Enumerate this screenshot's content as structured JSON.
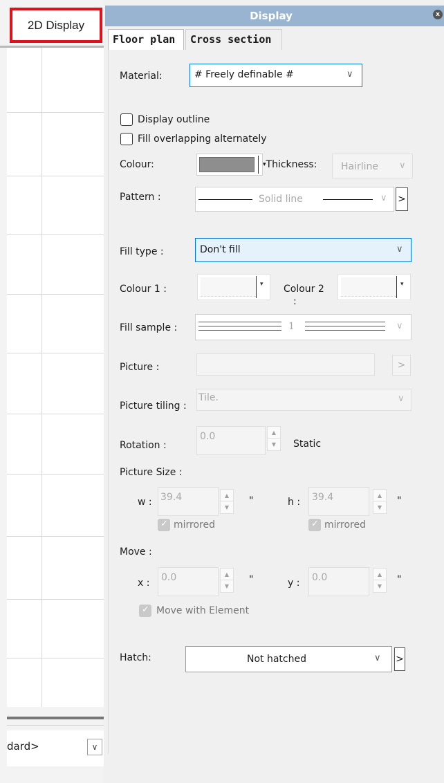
{
  "left": {
    "button_2d_display": "2D Display",
    "standard_select_value": "dard>"
  },
  "panel": {
    "title": "Display",
    "close_glyph": "x",
    "tabs": [
      "Floor plan",
      "Cross section"
    ],
    "material_label": "Material:",
    "material_value": "# Freely definable #",
    "display_outline_label": "Display outline",
    "display_outline_checked": false,
    "fill_overlapping_label": "Fill overlapping alternately",
    "fill_overlapping_checked": false,
    "colour_label": "Colour:",
    "colour_swatch": "#8e8e8e",
    "thickness_label": "Thickness:",
    "thickness_value": "Hairline",
    "pattern_label": "Pattern :",
    "pattern_value": "Solid line",
    "fill_type_label": "Fill type :",
    "fill_type_value": "Don't fill",
    "colour1_label": "Colour 1 :",
    "colour2_label": "Colour 2",
    "colour2_label_suffix": ":",
    "fill_sample_label": "Fill sample :",
    "fill_sample_value": "1",
    "picture_label": "Picture :",
    "picture_browse": ">",
    "picture_tiling_label": "Picture tiling :",
    "picture_tiling_value": "Tile.",
    "rotation_label": "Rotation :",
    "rotation_value": "0.0",
    "rotation_static_label": "Static",
    "picture_size_label": "Picture Size :",
    "w_label": "w :",
    "w_value": "39.4",
    "h_label": "h :",
    "h_value": "39.4",
    "unit_inch": "\"",
    "mirrored_w_label": "mirrored",
    "mirrored_w_checked": true,
    "mirrored_h_label": "mirrored",
    "mirrored_h_checked": true,
    "move_label": "Move :",
    "x_label": "x :",
    "x_value": "0.0",
    "y_label": "y :",
    "y_value": "0.0",
    "move_with_element_label": "Move with Element",
    "move_with_element_checked": true,
    "hatch_label": "Hatch:",
    "hatch_value": "Not hatched",
    "arrow_glyph": ">",
    "chevron_glyph": "∨"
  },
  "colors": {
    "highlight_border": "#e0111b",
    "titlebar": "#99b4d1",
    "focus_border": "#0078d7",
    "fill_type_bg": "#e5f1fb"
  },
  "icons": {
    "close": "close-icon",
    "dropdown": "chevron-down-icon",
    "spin_up": "spin-up-icon",
    "spin_down": "spin-down-icon"
  }
}
